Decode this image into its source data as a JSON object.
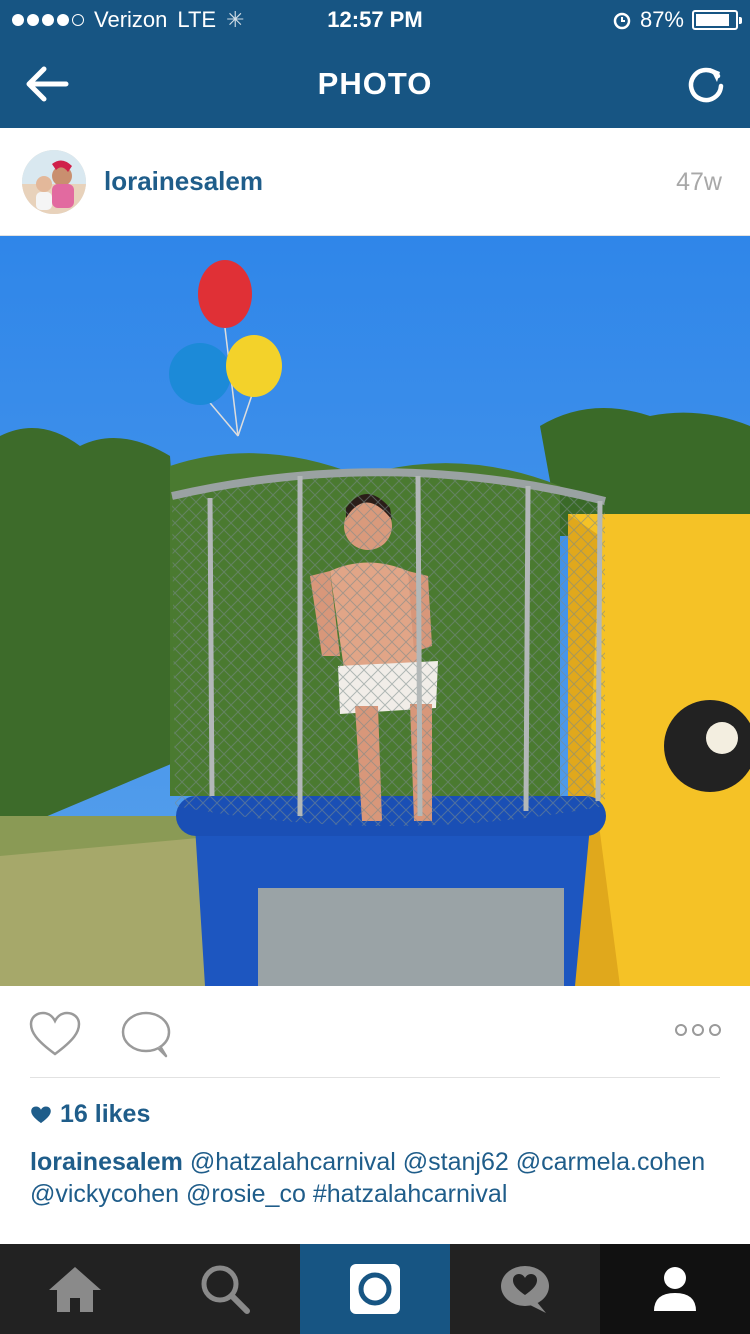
{
  "status_bar": {
    "carrier": "Verizon",
    "network": "LTE",
    "time": "12:57 PM",
    "battery": "87%",
    "battery_level": 0.87,
    "signal_bars": 4
  },
  "nav": {
    "title": "PHOTO",
    "back_icon": "arrow-left-icon",
    "refresh_icon": "refresh-icon"
  },
  "post": {
    "username": "lorainesalem",
    "time_ago": "47w",
    "likes": "16 likes",
    "caption": {
      "user": "lorainesalem",
      "text": "@hatzalahcarnival @stanj62 @carmela.cohen @vickycohen @rosie_co #hatzalahcarnival"
    }
  },
  "tabs": [
    {
      "name": "home",
      "icon": "home-icon"
    },
    {
      "name": "explore",
      "icon": "search-icon"
    },
    {
      "name": "camera",
      "icon": "camera-icon"
    },
    {
      "name": "activity",
      "icon": "activity-icon"
    },
    {
      "name": "profile",
      "icon": "profile-icon"
    }
  ],
  "colors": {
    "brand": "#175583",
    "link": "#1f5d8a",
    "tabbar": "#222222"
  }
}
